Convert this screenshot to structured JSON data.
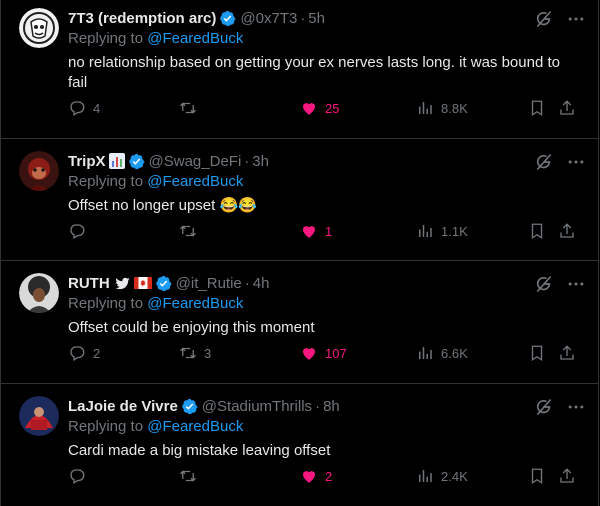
{
  "tweets": [
    {
      "name": "7T3 (redemption arc)",
      "handle": "@0x7T3",
      "time": "5h",
      "reply_prefix": "Replying to ",
      "reply_to": "@FearedBuck",
      "text": "no relationship based on getting your ex nerves lasts long. it was bound to fail",
      "replies": "4",
      "retweets": "",
      "likes": "25",
      "views": "8.8K"
    },
    {
      "name": "TripX",
      "handle": "@Swag_DeFi",
      "time": "3h",
      "reply_prefix": "Replying to ",
      "reply_to": "@FearedBuck",
      "text": "Offset no longer upset 😂😂",
      "replies": "",
      "retweets": "",
      "likes": "1",
      "views": "1.1K"
    },
    {
      "name": "RUTH",
      "handle": "@it_Rutie",
      "time": "4h",
      "reply_prefix": "Replying to ",
      "reply_to": "@FearedBuck",
      "text": "Offset could be enjoying this moment",
      "replies": "2",
      "retweets": "3",
      "likes": "107",
      "views": "6.6K"
    },
    {
      "name": "LaJoie de Vivre",
      "handle": "@StadiumThrills",
      "time": "8h",
      "reply_prefix": "Replying to ",
      "reply_to": "@FearedBuck",
      "text": "Cardi made a big mistake leaving offset",
      "replies": "",
      "retweets": "",
      "likes": "2",
      "views": "2.4K"
    }
  ],
  "colors": {
    "background": "#000000",
    "text": "#e7e9ea",
    "muted": "#71767b",
    "link": "#1d9bf0",
    "like": "#f91880",
    "border": "#2f3336"
  },
  "icons": [
    "verified-badge-icon",
    "grok-icon",
    "more-icon",
    "reply-icon",
    "retweet-icon",
    "heart-filled-icon",
    "views-icon",
    "bookmark-icon",
    "share-icon"
  ]
}
